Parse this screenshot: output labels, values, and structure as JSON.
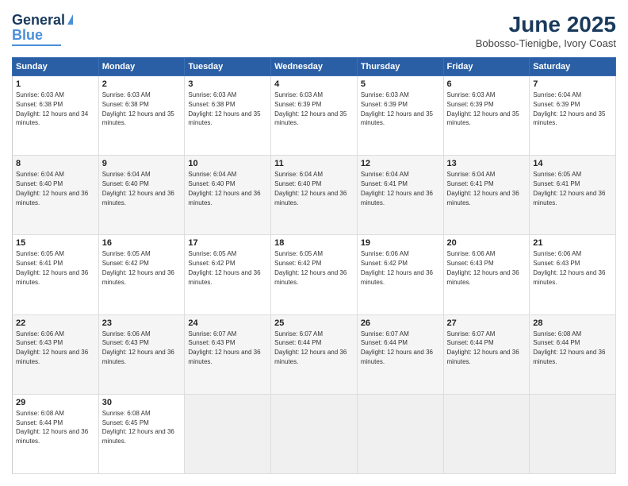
{
  "logo": {
    "line1": "General",
    "line2": "Blue"
  },
  "header": {
    "title": "June 2025",
    "location": "Bobosso-Tienigbe, Ivory Coast"
  },
  "days": [
    "Sunday",
    "Monday",
    "Tuesday",
    "Wednesday",
    "Thursday",
    "Friday",
    "Saturday"
  ],
  "weeks": [
    [
      {
        "day": 1,
        "sunrise": "6:03 AM",
        "sunset": "6:38 PM",
        "daylight": "12 hours and 34 minutes."
      },
      {
        "day": 2,
        "sunrise": "6:03 AM",
        "sunset": "6:38 PM",
        "daylight": "12 hours and 35 minutes."
      },
      {
        "day": 3,
        "sunrise": "6:03 AM",
        "sunset": "6:38 PM",
        "daylight": "12 hours and 35 minutes."
      },
      {
        "day": 4,
        "sunrise": "6:03 AM",
        "sunset": "6:39 PM",
        "daylight": "12 hours and 35 minutes."
      },
      {
        "day": 5,
        "sunrise": "6:03 AM",
        "sunset": "6:39 PM",
        "daylight": "12 hours and 35 minutes."
      },
      {
        "day": 6,
        "sunrise": "6:03 AM",
        "sunset": "6:39 PM",
        "daylight": "12 hours and 35 minutes."
      },
      {
        "day": 7,
        "sunrise": "6:04 AM",
        "sunset": "6:39 PM",
        "daylight": "12 hours and 35 minutes."
      }
    ],
    [
      {
        "day": 8,
        "sunrise": "6:04 AM",
        "sunset": "6:40 PM",
        "daylight": "12 hours and 36 minutes."
      },
      {
        "day": 9,
        "sunrise": "6:04 AM",
        "sunset": "6:40 PM",
        "daylight": "12 hours and 36 minutes."
      },
      {
        "day": 10,
        "sunrise": "6:04 AM",
        "sunset": "6:40 PM",
        "daylight": "12 hours and 36 minutes."
      },
      {
        "day": 11,
        "sunrise": "6:04 AM",
        "sunset": "6:40 PM",
        "daylight": "12 hours and 36 minutes."
      },
      {
        "day": 12,
        "sunrise": "6:04 AM",
        "sunset": "6:41 PM",
        "daylight": "12 hours and 36 minutes."
      },
      {
        "day": 13,
        "sunrise": "6:04 AM",
        "sunset": "6:41 PM",
        "daylight": "12 hours and 36 minutes."
      },
      {
        "day": 14,
        "sunrise": "6:05 AM",
        "sunset": "6:41 PM",
        "daylight": "12 hours and 36 minutes."
      }
    ],
    [
      {
        "day": 15,
        "sunrise": "6:05 AM",
        "sunset": "6:41 PM",
        "daylight": "12 hours and 36 minutes."
      },
      {
        "day": 16,
        "sunrise": "6:05 AM",
        "sunset": "6:42 PM",
        "daylight": "12 hours and 36 minutes."
      },
      {
        "day": 17,
        "sunrise": "6:05 AM",
        "sunset": "6:42 PM",
        "daylight": "12 hours and 36 minutes."
      },
      {
        "day": 18,
        "sunrise": "6:05 AM",
        "sunset": "6:42 PM",
        "daylight": "12 hours and 36 minutes."
      },
      {
        "day": 19,
        "sunrise": "6:06 AM",
        "sunset": "6:42 PM",
        "daylight": "12 hours and 36 minutes."
      },
      {
        "day": 20,
        "sunrise": "6:06 AM",
        "sunset": "6:43 PM",
        "daylight": "12 hours and 36 minutes."
      },
      {
        "day": 21,
        "sunrise": "6:06 AM",
        "sunset": "6:43 PM",
        "daylight": "12 hours and 36 minutes."
      }
    ],
    [
      {
        "day": 22,
        "sunrise": "6:06 AM",
        "sunset": "6:43 PM",
        "daylight": "12 hours and 36 minutes."
      },
      {
        "day": 23,
        "sunrise": "6:06 AM",
        "sunset": "6:43 PM",
        "daylight": "12 hours and 36 minutes."
      },
      {
        "day": 24,
        "sunrise": "6:07 AM",
        "sunset": "6:43 PM",
        "daylight": "12 hours and 36 minutes."
      },
      {
        "day": 25,
        "sunrise": "6:07 AM",
        "sunset": "6:44 PM",
        "daylight": "12 hours and 36 minutes."
      },
      {
        "day": 26,
        "sunrise": "6:07 AM",
        "sunset": "6:44 PM",
        "daylight": "12 hours and 36 minutes."
      },
      {
        "day": 27,
        "sunrise": "6:07 AM",
        "sunset": "6:44 PM",
        "daylight": "12 hours and 36 minutes."
      },
      {
        "day": 28,
        "sunrise": "6:08 AM",
        "sunset": "6:44 PM",
        "daylight": "12 hours and 36 minutes."
      }
    ],
    [
      {
        "day": 29,
        "sunrise": "6:08 AM",
        "sunset": "6:44 PM",
        "daylight": "12 hours and 36 minutes."
      },
      {
        "day": 30,
        "sunrise": "6:08 AM",
        "sunset": "6:45 PM",
        "daylight": "12 hours and 36 minutes."
      },
      null,
      null,
      null,
      null,
      null
    ]
  ]
}
